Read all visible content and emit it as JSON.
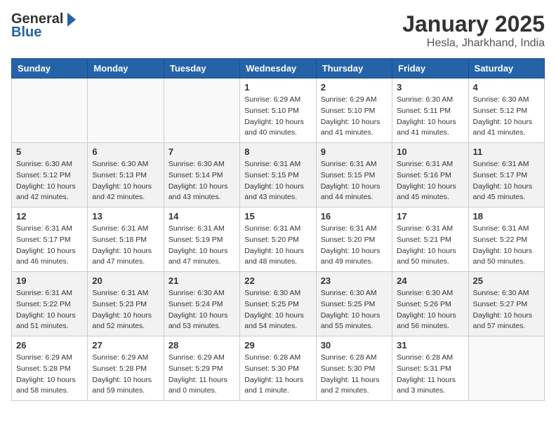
{
  "header": {
    "logo_general": "General",
    "logo_blue": "Blue",
    "month": "January 2025",
    "location": "Hesla, Jharkhand, India"
  },
  "weekdays": [
    "Sunday",
    "Monday",
    "Tuesday",
    "Wednesday",
    "Thursday",
    "Friday",
    "Saturday"
  ],
  "weeks": [
    [
      {
        "day": "",
        "info": ""
      },
      {
        "day": "",
        "info": ""
      },
      {
        "day": "",
        "info": ""
      },
      {
        "day": "1",
        "info": "Sunrise: 6:29 AM\nSunset: 5:10 PM\nDaylight: 10 hours\nand 40 minutes."
      },
      {
        "day": "2",
        "info": "Sunrise: 6:29 AM\nSunset: 5:10 PM\nDaylight: 10 hours\nand 41 minutes."
      },
      {
        "day": "3",
        "info": "Sunrise: 6:30 AM\nSunset: 5:11 PM\nDaylight: 10 hours\nand 41 minutes."
      },
      {
        "day": "4",
        "info": "Sunrise: 6:30 AM\nSunset: 5:12 PM\nDaylight: 10 hours\nand 41 minutes."
      }
    ],
    [
      {
        "day": "5",
        "info": "Sunrise: 6:30 AM\nSunset: 5:12 PM\nDaylight: 10 hours\nand 42 minutes."
      },
      {
        "day": "6",
        "info": "Sunrise: 6:30 AM\nSunset: 5:13 PM\nDaylight: 10 hours\nand 42 minutes."
      },
      {
        "day": "7",
        "info": "Sunrise: 6:30 AM\nSunset: 5:14 PM\nDaylight: 10 hours\nand 43 minutes."
      },
      {
        "day": "8",
        "info": "Sunrise: 6:31 AM\nSunset: 5:15 PM\nDaylight: 10 hours\nand 43 minutes."
      },
      {
        "day": "9",
        "info": "Sunrise: 6:31 AM\nSunset: 5:15 PM\nDaylight: 10 hours\nand 44 minutes."
      },
      {
        "day": "10",
        "info": "Sunrise: 6:31 AM\nSunset: 5:16 PM\nDaylight: 10 hours\nand 45 minutes."
      },
      {
        "day": "11",
        "info": "Sunrise: 6:31 AM\nSunset: 5:17 PM\nDaylight: 10 hours\nand 45 minutes."
      }
    ],
    [
      {
        "day": "12",
        "info": "Sunrise: 6:31 AM\nSunset: 5:17 PM\nDaylight: 10 hours\nand 46 minutes."
      },
      {
        "day": "13",
        "info": "Sunrise: 6:31 AM\nSunset: 5:18 PM\nDaylight: 10 hours\nand 47 minutes."
      },
      {
        "day": "14",
        "info": "Sunrise: 6:31 AM\nSunset: 5:19 PM\nDaylight: 10 hours\nand 47 minutes."
      },
      {
        "day": "15",
        "info": "Sunrise: 6:31 AM\nSunset: 5:20 PM\nDaylight: 10 hours\nand 48 minutes."
      },
      {
        "day": "16",
        "info": "Sunrise: 6:31 AM\nSunset: 5:20 PM\nDaylight: 10 hours\nand 49 minutes."
      },
      {
        "day": "17",
        "info": "Sunrise: 6:31 AM\nSunset: 5:21 PM\nDaylight: 10 hours\nand 50 minutes."
      },
      {
        "day": "18",
        "info": "Sunrise: 6:31 AM\nSunset: 5:22 PM\nDaylight: 10 hours\nand 50 minutes."
      }
    ],
    [
      {
        "day": "19",
        "info": "Sunrise: 6:31 AM\nSunset: 5:22 PM\nDaylight: 10 hours\nand 51 minutes."
      },
      {
        "day": "20",
        "info": "Sunrise: 6:31 AM\nSunset: 5:23 PM\nDaylight: 10 hours\nand 52 minutes."
      },
      {
        "day": "21",
        "info": "Sunrise: 6:30 AM\nSunset: 5:24 PM\nDaylight: 10 hours\nand 53 minutes."
      },
      {
        "day": "22",
        "info": "Sunrise: 6:30 AM\nSunset: 5:25 PM\nDaylight: 10 hours\nand 54 minutes."
      },
      {
        "day": "23",
        "info": "Sunrise: 6:30 AM\nSunset: 5:25 PM\nDaylight: 10 hours\nand 55 minutes."
      },
      {
        "day": "24",
        "info": "Sunrise: 6:30 AM\nSunset: 5:26 PM\nDaylight: 10 hours\nand 56 minutes."
      },
      {
        "day": "25",
        "info": "Sunrise: 6:30 AM\nSunset: 5:27 PM\nDaylight: 10 hours\nand 57 minutes."
      }
    ],
    [
      {
        "day": "26",
        "info": "Sunrise: 6:29 AM\nSunset: 5:28 PM\nDaylight: 10 hours\nand 58 minutes."
      },
      {
        "day": "27",
        "info": "Sunrise: 6:29 AM\nSunset: 5:28 PM\nDaylight: 10 hours\nand 59 minutes."
      },
      {
        "day": "28",
        "info": "Sunrise: 6:29 AM\nSunset: 5:29 PM\nDaylight: 11 hours\nand 0 minutes."
      },
      {
        "day": "29",
        "info": "Sunrise: 6:28 AM\nSunset: 5:30 PM\nDaylight: 11 hours\nand 1 minute."
      },
      {
        "day": "30",
        "info": "Sunrise: 6:28 AM\nSunset: 5:30 PM\nDaylight: 11 hours\nand 2 minutes."
      },
      {
        "day": "31",
        "info": "Sunrise: 6:28 AM\nSunset: 5:31 PM\nDaylight: 11 hours\nand 3 minutes."
      },
      {
        "day": "",
        "info": ""
      }
    ]
  ]
}
